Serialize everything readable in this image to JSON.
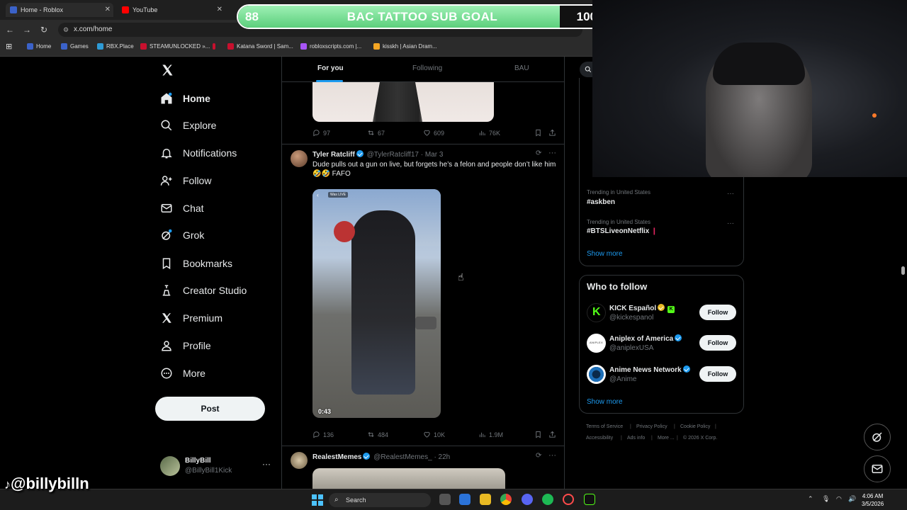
{
  "browser": {
    "tabs": [
      {
        "label": "Home - Roblox",
        "color": "#3b62c9"
      },
      {
        "label": "YouTube",
        "color": "#ff0000"
      }
    ],
    "url": "x.com/home",
    "bookmarks": [
      {
        "label": "Home",
        "color": "#3b62c9"
      },
      {
        "label": "Games",
        "color": "#3b62c9"
      },
      {
        "label": "RBX.Place",
        "color": "#2e9bd6"
      },
      {
        "label": "STEAMUNLOCKED »...",
        "color": "#c8102e"
      },
      {
        "label": "Katana Sword | Sam...",
        "color": "#c8102e"
      },
      {
        "label": "robloxscripts.com |...",
        "color": "#a855f7"
      },
      {
        "label": "kisskh | Asian Dram...",
        "color": "#f5a623"
      }
    ]
  },
  "overlay": {
    "subgoal_current": "88",
    "subgoal_title": "BAC TATTOO SUB GOAL",
    "subgoal_max": "100",
    "subgoal_progress": 0.88,
    "watermark": "@billybilln"
  },
  "nav": {
    "items": [
      "Home",
      "Explore",
      "Notifications",
      "Follow",
      "Chat",
      "Grok",
      "Bookmarks",
      "Creator Studio",
      "Premium",
      "Profile",
      "More"
    ],
    "post_label": "Post",
    "account_name": "BillyBill",
    "account_handle": "@BillyBill1Kick"
  },
  "feed": {
    "tabs": [
      "For you",
      "Following",
      "BAU"
    ],
    "tweet0_stats": {
      "replies": "97",
      "reposts": "67",
      "likes": "609",
      "views": "76K"
    },
    "tweet1": {
      "name": "Tyler Ratcliff",
      "handle": "@TylerRatcliff17",
      "date": "· Mar 3",
      "text": "Dude pulls out a gun on live, but forgets he’s a felon and people don’t like him🤣🤣 FAFO",
      "video_duration": "0:43",
      "video_badge": "Was LIVE",
      "stats": {
        "replies": "136",
        "reposts": "484",
        "likes": "10K",
        "views": "1.9M"
      }
    },
    "tweet2": {
      "name": "RealestMemes",
      "handle": "@RealestMemes_",
      "date": "· 22h"
    }
  },
  "sidebar": {
    "trends": [
      {
        "context": "Trending in United States",
        "name": "#askben"
      },
      {
        "context": "Trending in United States",
        "name": "#BTSLiveonNetflix"
      }
    ],
    "show_more": "Show more",
    "who_to_follow_title": "Who to follow",
    "suggestions": [
      {
        "name": "KICK Español",
        "handle": "@kickespanol",
        "color": "#53fc18"
      },
      {
        "name": "Aniplex of America",
        "handle": "@aniplexUSA",
        "color": "#ffffff"
      },
      {
        "name": "Anime News Network",
        "handle": "@Anime",
        "color": "#1d6fb8"
      }
    ],
    "follow_label": "Follow",
    "footer": [
      "Terms of Service",
      "Privacy Policy",
      "Cookie Policy",
      "Accessibility",
      "Ads info",
      "More ...",
      "© 2026 X Corp."
    ]
  },
  "taskbar": {
    "search": "Search",
    "time": "4:06 AM",
    "date": "3/5/2026"
  }
}
